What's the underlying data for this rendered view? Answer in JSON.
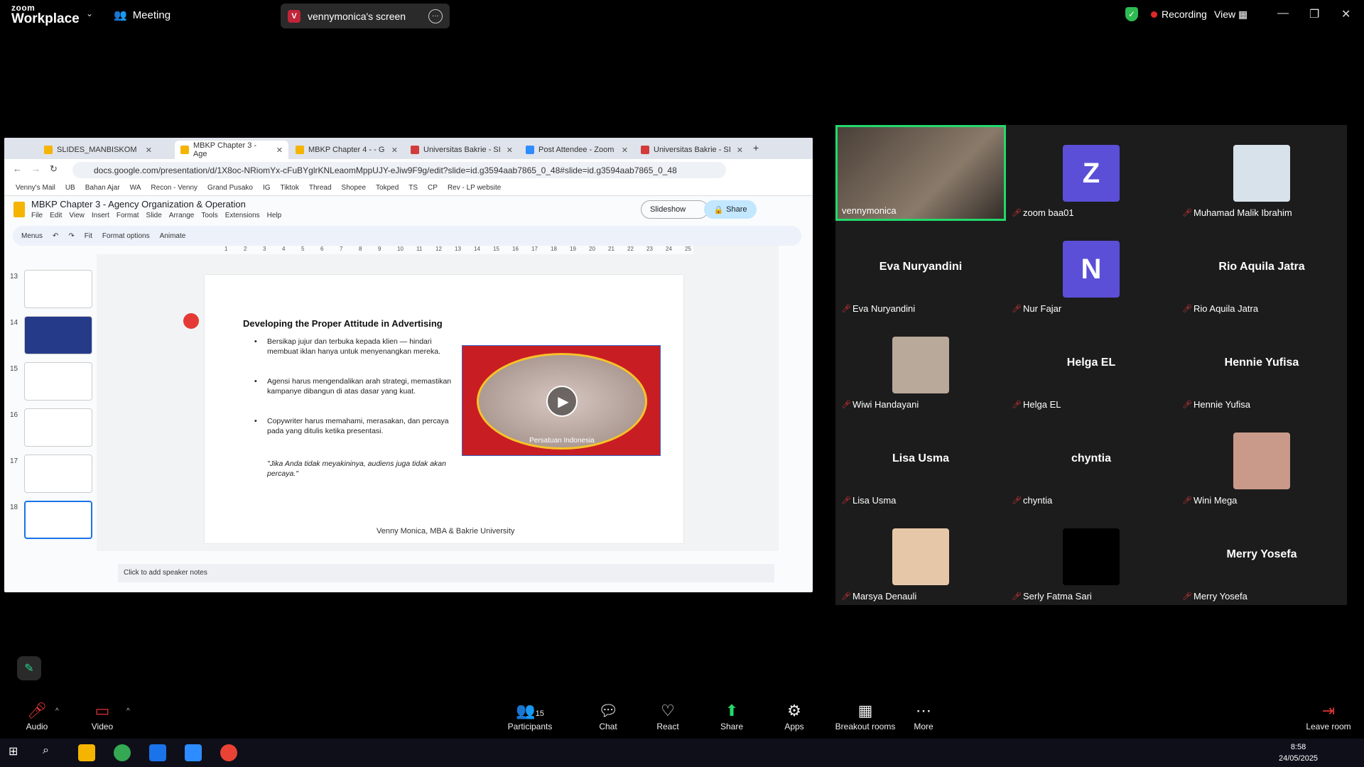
{
  "zoom": {
    "logo_line1": "zoom",
    "logo_line2": "Workplace",
    "meeting_label": "Meeting",
    "share_title": "vennymonica's screen",
    "recording": "Recording",
    "view": "View"
  },
  "browser": {
    "tabs": [
      {
        "label": "SLIDES_MANBISKOM"
      },
      {
        "label": "MBKP Chapter 3 - Age"
      },
      {
        "label": "MBKP Chapter 4 - - G"
      },
      {
        "label": "Universitas Bakrie - SI"
      },
      {
        "label": "Post Attendee - Zoom"
      },
      {
        "label": "Universitas Bakrie - SI"
      }
    ],
    "url": "docs.google.com/presentation/d/1X8oc-NRiomYx-cFuBYglrKNLeaomMppUJY-eJiw9F9g/edit?slide=id.g3594aab7865_0_48#slide=id.g3594aab7865_0_48",
    "bookmarks": [
      "Venny's Mail",
      "UB",
      "Bahan Ajar",
      "WA",
      "Recon - Venny",
      "Grand Pusako",
      "IG",
      "Tiktok",
      "Thread",
      "Shopee",
      "Tokped",
      "TS",
      "CP",
      "Rev - LP website"
    ]
  },
  "slides": {
    "title": "MBKP Chapter 3 - Agency Organization & Operation",
    "menu": [
      "File",
      "Edit",
      "View",
      "Insert",
      "Format",
      "Slide",
      "Arrange",
      "Tools",
      "Extensions",
      "Help"
    ],
    "slideshow": "Slideshow",
    "share": "Share",
    "toolbar": [
      "Menus",
      "Fit",
      "Format options",
      "Animate"
    ],
    "thumb_numbers": [
      "13",
      "14",
      "15",
      "16",
      "17",
      "18"
    ],
    "ruler": [
      "1",
      "2",
      "3",
      "4",
      "5",
      "6",
      "7",
      "8",
      "9",
      "10",
      "11",
      "12",
      "13",
      "14",
      "15",
      "16",
      "17",
      "18",
      "19",
      "20",
      "21",
      "22",
      "23",
      "24",
      "25"
    ],
    "speaker_notes": "Click to add speaker notes"
  },
  "slide": {
    "title": "Developing the Proper Attitude in Advertising",
    "bullets": [
      "Bersikap jujur dan terbuka kepada klien — hindari membuat iklan hanya untuk menyenangkan mereka.",
      "Agensi harus mengendalikan arah strategi, memastikan kampanye dibangun di atas dasar yang kuat.",
      "Copywriter harus memahami, merasakan, dan percaya pada yang ditulis ketika presentasi."
    ],
    "quote": "\"Jika Anda tidak meyakininya, audiens juga tidak akan percaya.\"",
    "video_caption": "Persatuan Indonesia",
    "footer": "Venny Monica, MBA & Bakrie University"
  },
  "gallery": [
    {
      "name": "vennymonica",
      "type": "video",
      "color": "#8a7a6a"
    },
    {
      "name": "zoom baa01",
      "type": "letter",
      "letter": "Z",
      "color": "#5b4fd8"
    },
    {
      "name": "Muhamad Malik Ibrahim",
      "type": "photo",
      "color": "#d8e2ea"
    },
    {
      "name": "Eva Nuryandini",
      "type": "text",
      "display": "Eva Nuryandini"
    },
    {
      "name": "Nur Fajar",
      "type": "letter",
      "letter": "N",
      "color": "#5b4fd8"
    },
    {
      "name": "Rio Aquila Jatra",
      "type": "text",
      "display": "Rio Aquila Jatra"
    },
    {
      "name": "Wiwi Handayani",
      "type": "photo",
      "color": "#b9a99a"
    },
    {
      "name": "Helga EL",
      "type": "text",
      "display": "Helga EL"
    },
    {
      "name": "Hennie Yufisa",
      "type": "text",
      "display": "Hennie Yufisa"
    },
    {
      "name": "Lisa Usma",
      "type": "text",
      "display": "Lisa Usma"
    },
    {
      "name": "chyntia",
      "type": "text",
      "display": "chyntia"
    },
    {
      "name": "Wini Mega",
      "type": "photo",
      "color": "#c99a8a"
    },
    {
      "name": "Marsya Denauli",
      "type": "photo",
      "color": "#e6c8a8"
    },
    {
      "name": "Serly Fatma Sari",
      "type": "black",
      "color": "#000000"
    },
    {
      "name": "Merry Yosefa",
      "type": "text",
      "display": "Merry Yosefa"
    }
  ],
  "bottom": {
    "audio": "Audio",
    "video": "Video",
    "participants_count": "15",
    "participants": "Participants",
    "chat": "Chat",
    "react": "React",
    "share": "Share",
    "apps": "Apps",
    "breakout": "Breakout rooms",
    "more": "More",
    "leave": "Leave room"
  },
  "clock": {
    "time": "8:58",
    "date": "24/05/2025"
  }
}
